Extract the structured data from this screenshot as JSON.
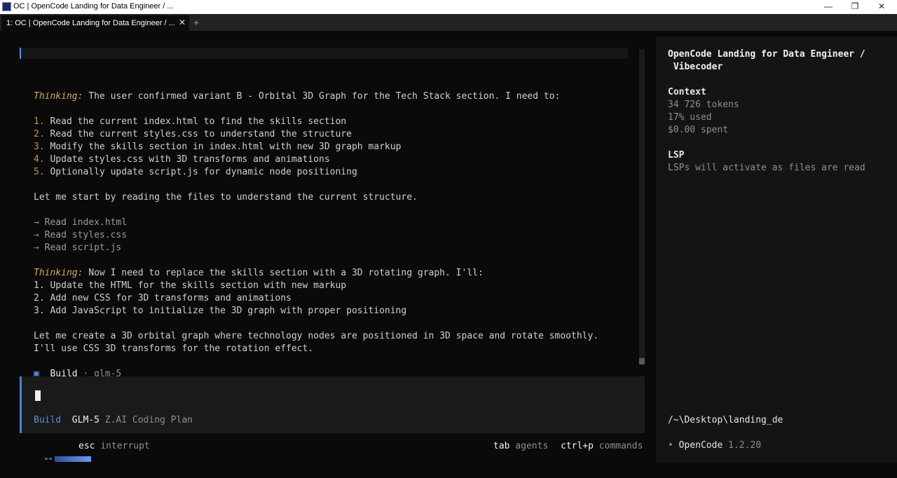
{
  "window": {
    "title": "OC | OpenCode Landing for Data Engineer / ...",
    "tab_label": "1: OC | OpenCode Landing for Data Engineer / ...",
    "tab_close": "✕",
    "new_tab": "+",
    "btn_minimize": "—",
    "btn_maximize": "❐",
    "btn_close": "✕"
  },
  "conversation": {
    "thinking_label": "Thinking:",
    "thinking1_text": " The user confirmed variant B - Orbital 3D Graph for the Tech Stack section. I need to:",
    "steps1": [
      {
        "num": "1.",
        "text": " Read the current index.html to find the skills section"
      },
      {
        "num": "2.",
        "text": " Read the current styles.css to understand the structure"
      },
      {
        "num": "3.",
        "text": " Modify the skills section in index.html with new 3D graph markup"
      },
      {
        "num": "4.",
        "text": " Update styles.css with 3D transforms and animations"
      },
      {
        "num": "5.",
        "text": " Optionally update script.js for dynamic node positioning"
      }
    ],
    "para1": "Let me start by reading the files to understand the current structure.",
    "arrow": "→",
    "reads": [
      " Read index.html",
      " Read styles.css",
      " Read script.js"
    ],
    "thinking2_text": " Now I need to replace the skills section with a 3D rotating graph. I'll:",
    "steps2": [
      "1. Update the HTML for the skills section with new markup",
      "2. Add new CSS for 3D transforms and animations",
      "3. Add JavaScript to initialize the 3D graph with proper positioning"
    ],
    "para2_line1": "Let me create a 3D orbital graph where technology nodes are positioned in 3D space and rotate smoothly.",
    "para2_line2": "I'll use CSS 3D transforms for the rotation effect.",
    "build_icon": "▣",
    "build_label": "Build",
    "build_sep": " · ",
    "build_model": "glm-5"
  },
  "prompt": {
    "mode": "Build",
    "model": "GLM-5",
    "provider": "Z.AI Coding Plan"
  },
  "status": {
    "esc_key": "esc",
    "esc_action": "interrupt",
    "tab_key": "tab",
    "tab_action": "agents",
    "ctrlp_key": "ctrl+p",
    "ctrlp_action": "commands"
  },
  "sidebar": {
    "title_line1": "OpenCode Landing for Data Engineer /",
    "title_line2": " Vibecoder",
    "context_heading": "Context",
    "tokens": "34 726 tokens",
    "used": "17% used",
    "spent": "$0.00 spent",
    "lsp_heading": "LSP",
    "lsp_text": "LSPs will activate as files are read",
    "path": "/~\\Desktop\\landing_de",
    "dot": "•",
    "app_name": "OpenCode",
    "version": "1.2.20"
  },
  "colors": {
    "accent_blue": "#5b8dd9",
    "thinking": "#d3a95e",
    "numbers": "#d08d4e",
    "status_dot": "#4caf50"
  }
}
